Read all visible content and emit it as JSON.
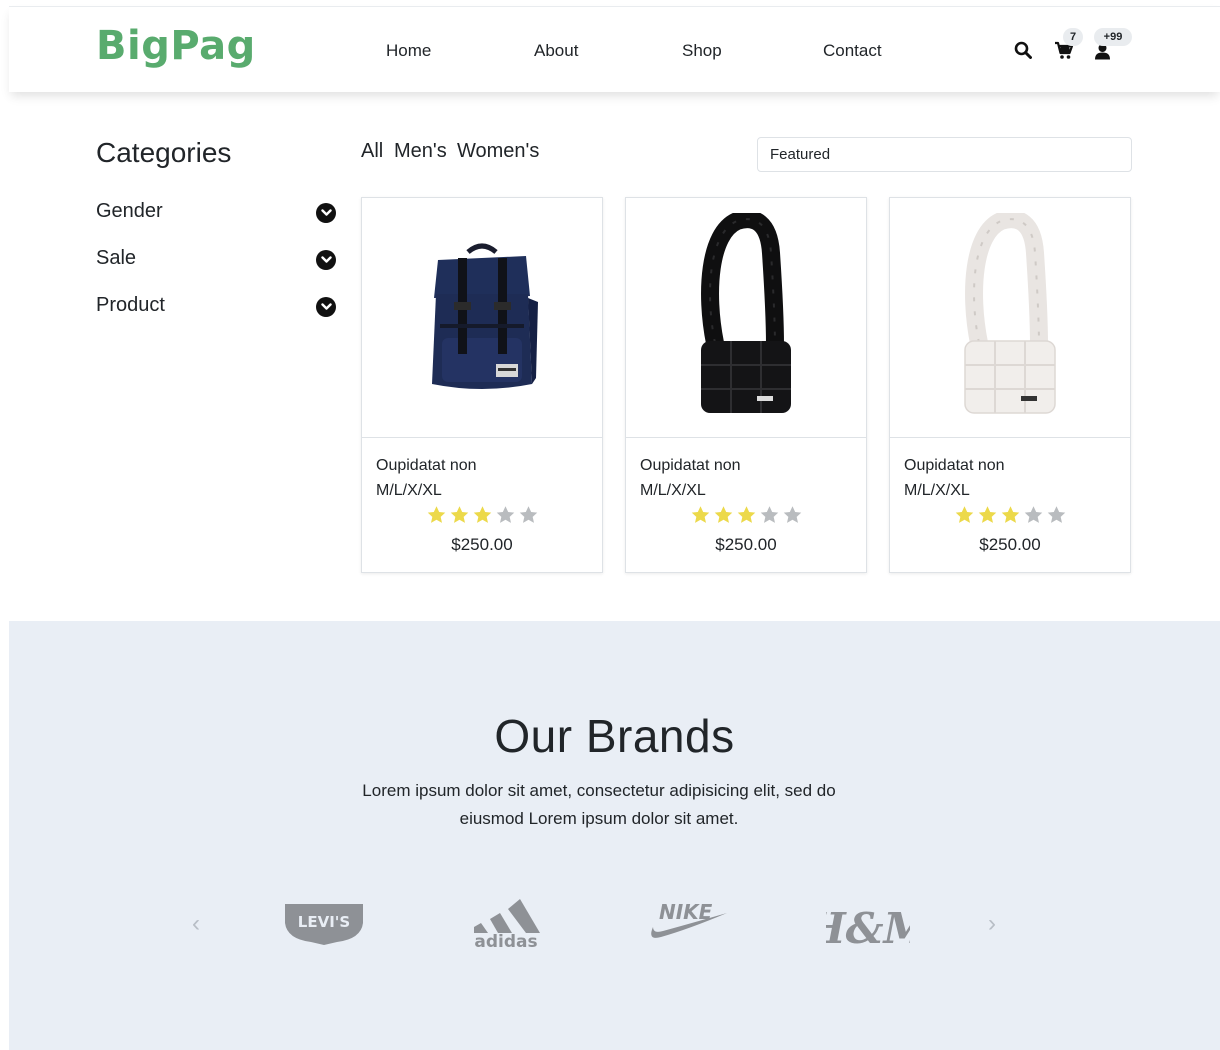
{
  "brand": {
    "logo": "BigPag",
    "color": "#59ab6e"
  },
  "nav": {
    "links": [
      "Home",
      "About",
      "Shop",
      "Contact"
    ],
    "cart_count": "7",
    "user_count": "+99"
  },
  "sidebar": {
    "title": "Categories",
    "items": [
      {
        "label": "Gender",
        "icon": "chevron-down-circle-icon"
      },
      {
        "label": "Sale",
        "icon": "chevron-down-circle-icon"
      },
      {
        "label": "Product",
        "icon": "chevron-down-circle-icon"
      }
    ]
  },
  "filters": {
    "tabs": [
      "All",
      "Men's",
      "Women's"
    ],
    "sort_selected": "Featured"
  },
  "products": [
    {
      "name": "Oupidatat non",
      "sizes": "M/L/X/XL",
      "rating": 3,
      "max_rating": 5,
      "price": "$250.00",
      "image": "navy-backpack"
    },
    {
      "name": "Oupidatat non",
      "sizes": "M/L/X/XL",
      "rating": 3,
      "max_rating": 5,
      "price": "$250.00",
      "image": "black-puffer-bag"
    },
    {
      "name": "Oupidatat non",
      "sizes": "M/L/X/XL",
      "rating": 3,
      "max_rating": 5,
      "price": "$250.00",
      "image": "white-puffer-bag"
    }
  ],
  "brands": {
    "title": "Our Brands",
    "text": "Lorem ipsum dolor sit amet, consectetur adipisicing elit, sed do eiusmod Lorem ipsum dolor sit amet.",
    "prev_arrow": "‹",
    "next_arrow": "›",
    "logos": [
      {
        "name": "Levi's",
        "label": "LEVI'S"
      },
      {
        "name": "adidas",
        "label": "adidas"
      },
      {
        "name": "Nike",
        "label": "NIKE"
      },
      {
        "name": "H&M",
        "label": "H&M"
      }
    ]
  },
  "colors": {
    "star_filled": "#ecd94a",
    "star_empty": "#b9bcbf",
    "brands_bg": "#e9eef5",
    "brand_logo": "#8e9196"
  }
}
